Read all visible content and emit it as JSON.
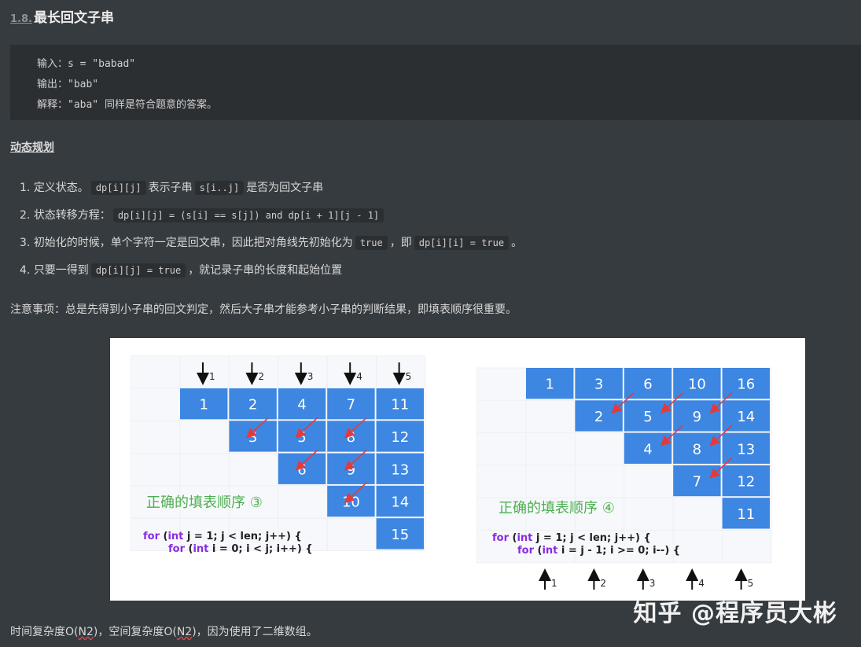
{
  "heading": {
    "number": "1.8.",
    "title": "最长回文子串"
  },
  "example": {
    "lines": [
      "输入：s = \"babad\"",
      "输出：\"bab\"",
      "解释：\"aba\" 同样是符合题意的答案。"
    ]
  },
  "section_title": "动态规划",
  "steps": [
    {
      "n": "1.",
      "pre": "定义状态。",
      "c1": "dp[i][j]",
      "mid": "表示子串",
      "c2": "s[i..j]",
      "post": "是否为回文子串"
    },
    {
      "n": "2.",
      "pre": "状态转移方程：",
      "c1": "dp[i][j] = (s[i] == s[j]) and dp[i + 1][j - 1]"
    },
    {
      "n": "3.",
      "pre": "初始化的时候，单个字符一定是回文串，因此把对角线先初始化为",
      "c1": "true",
      "mid": "，即",
      "c2": "dp[i][i] = true",
      "post": "。"
    },
    {
      "n": "4.",
      "pre": "只要一得到",
      "c1": "dp[i][j] = true",
      "mid": "，就记录子串的长度和起始位置"
    }
  ],
  "note": "注意事项：总是先得到小子串的回文判定，然后大子串才能参考小子串的判断结果，即填表顺序很重要。",
  "figure": {
    "left": {
      "arrows": [
        "1",
        "2",
        "3",
        "4",
        "5"
      ],
      "caption": "正确的填表顺序 ③",
      "code1": "for (int j = 1; j < len; j++) {",
      "code2": "for (int i = 0; i < j; i++) {",
      "cells": [
        "1",
        "2",
        "4",
        "7",
        "11",
        "3",
        "5",
        "8",
        "12",
        "6",
        "9",
        "13",
        "10",
        "14",
        "15"
      ]
    },
    "right": {
      "arrows": [
        "1",
        "2",
        "3",
        "4",
        "5"
      ],
      "caption": "正确的填表顺序 ④",
      "code1": "for (int j = 1; j < len; j++) {",
      "code2": "for (int i = j - 1; i >= 0; i--) {",
      "cells": [
        "1",
        "3",
        "6",
        "10",
        "16",
        "2",
        "5",
        "9",
        "14",
        "4",
        "8",
        "13",
        "7",
        "12",
        "11"
      ]
    },
    "colors": {
      "cell": "#3d86e2",
      "cell_text": "#ffffff",
      "arrow": "#e33b3b",
      "caption": "#4caf50",
      "keyword": "#8a2be2"
    }
  },
  "footer": {
    "a": "时间复杂度O(",
    "n1": "N2",
    "b": ")，空间复杂度O(",
    "n2": "N2",
    "c": ")，因为使用了二维数组。"
  },
  "watermark": "知乎 @程序员大彬"
}
